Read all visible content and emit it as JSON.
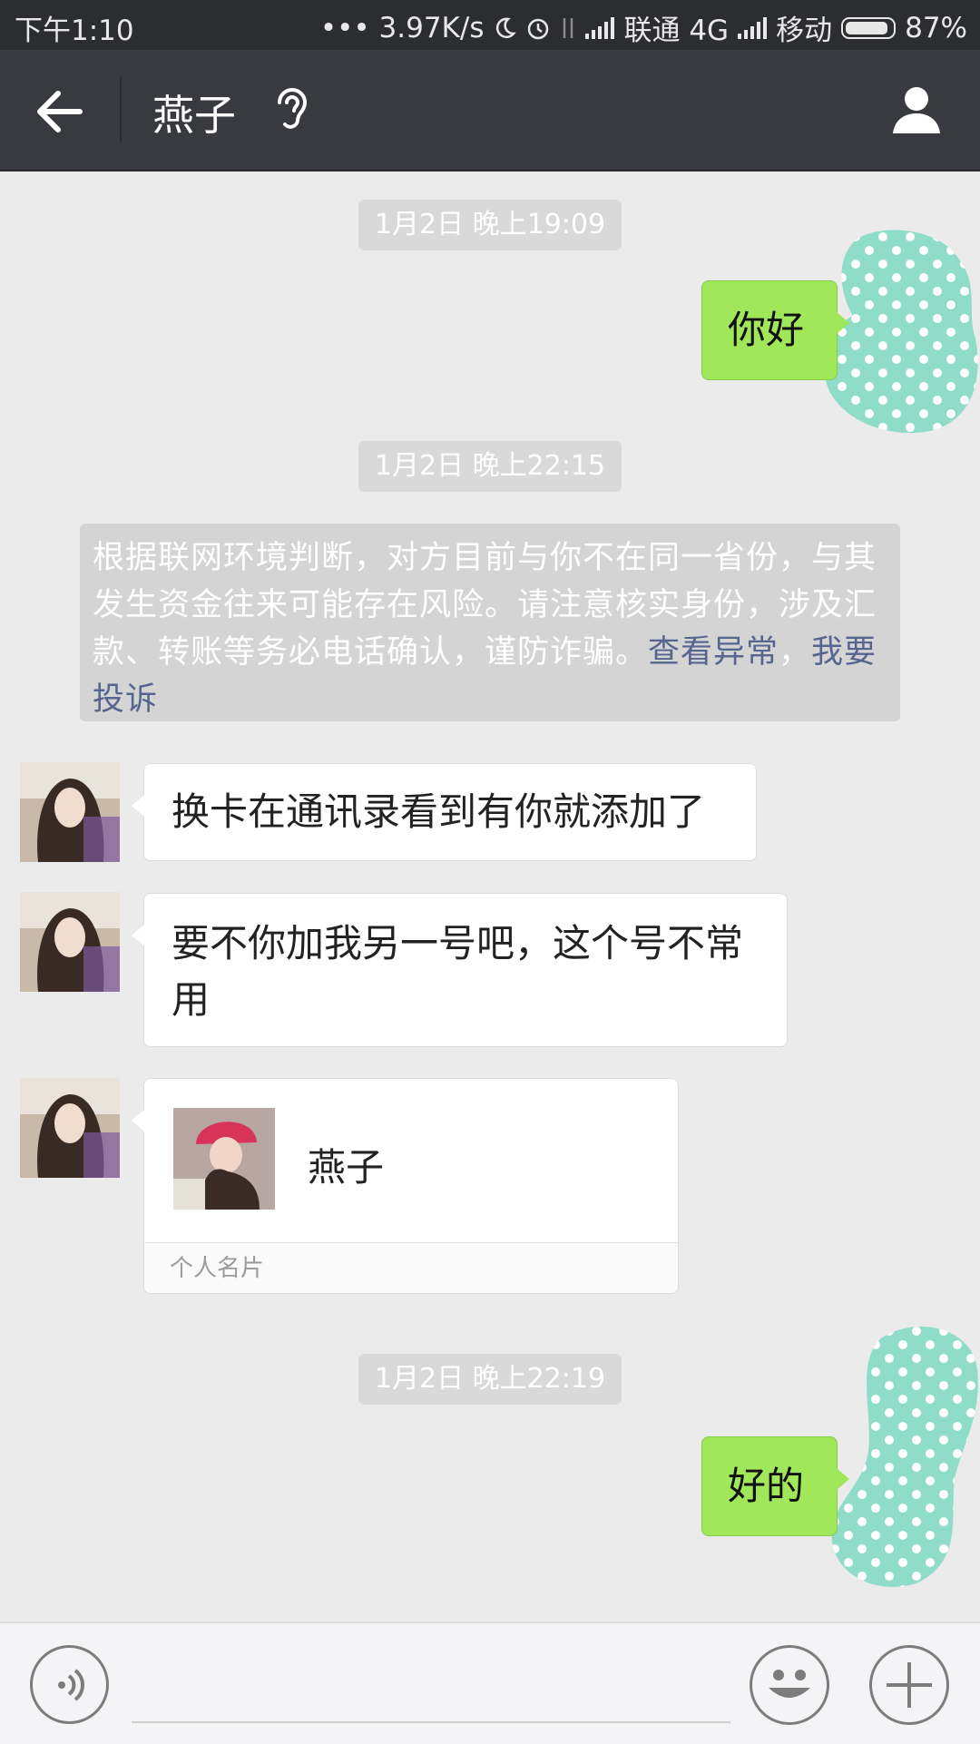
{
  "status_bar": {
    "time": "下午1:10",
    "speed": "••• 3.97K/s",
    "carrier1": "联通 4G",
    "carrier2": "移动",
    "battery": "87%"
  },
  "header": {
    "title": "燕子"
  },
  "messages": {
    "time1": "1月2日 晚上19:09",
    "out1": "你好",
    "time2": "1月2日 晚上22:15",
    "warning_text": "根据联网环境判断，对方目前与你不在同一省份，与其发生资金往来可能存在风险。请注意核实身份，涉及汇款、转账等务必电话确认，谨防诈骗。",
    "warning_link1": "查看异常",
    "warning_sep": "，",
    "warning_link2": "我要投诉",
    "in1": "换卡在通讯录看到有你就添加了",
    "in2": "要不你加我另一号吧，这个号不常用",
    "card_name": "燕子",
    "card_footer": "个人名片",
    "time3": "1月2日 晚上22:19",
    "out2": "好的"
  },
  "colors": {
    "accent_green": "#a0e75a",
    "header_bg": "#393a3f",
    "status_bg": "#2c2d30",
    "link": "#56658f",
    "blob": "#8fdcc9"
  },
  "icons": [
    "back-arrow-icon",
    "ear-icon",
    "profile-icon",
    "voice-icon",
    "emoji-icon",
    "plus-icon"
  ]
}
